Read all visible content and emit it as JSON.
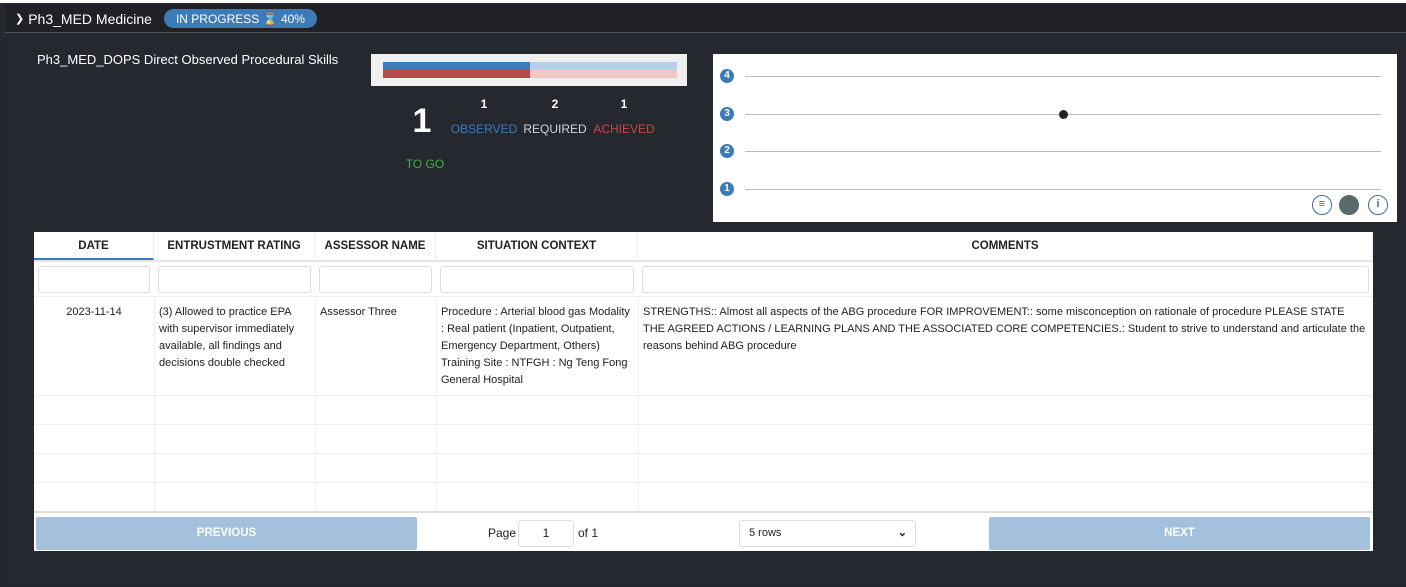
{
  "header": {
    "title": "Ph3_MED Medicine",
    "status": "IN PROGRESS",
    "progress": "40%"
  },
  "module": {
    "title": "Ph3_MED_DOPS Direct Observed Procedural Skills",
    "to_go": {
      "value": "1",
      "label": "TO GO"
    },
    "observed": {
      "value": "1",
      "label": "OBSERVED"
    },
    "required": {
      "value": "2",
      "label": "REQUIRED"
    },
    "achieved": {
      "value": "1",
      "label": "ACHIEVED"
    },
    "bar_fill_fraction": 0.5,
    "colors": {
      "observed": "#3d7ab8",
      "achieved": "#b94a4a",
      "to_go": "#3cb043"
    }
  },
  "chart_data": {
    "type": "scatter",
    "yticks": [
      "1",
      "2",
      "3",
      "4"
    ],
    "ylim": [
      1,
      4
    ],
    "grid": true,
    "points": [
      {
        "x": "2023-11-14",
        "x_fraction": 0.5,
        "y": 3
      }
    ],
    "icons": [
      "sliders-icon",
      "chart-action-icon",
      "info-icon"
    ]
  },
  "table": {
    "columns": [
      "DATE",
      "ENTRUSTMENT RATING",
      "ASSESSOR NAME",
      "SITUATION CONTEXT",
      "COMMENTS"
    ],
    "rows": [
      [
        "2023-11-14",
        "(3) Allowed to practice EPA with supervisor immediately available, all findings and decisions double checked",
        "Assessor Three",
        "Procedure : Arterial blood gas Modality : Real patient (Inpatient, Outpatient, Emergency Department, Others) Training Site : NTFGH : Ng Teng Fong General Hospital",
        "STRENGTHS:: Almost all aspects of the ABG procedure FOR IMPROVEMENT:: some misconception on rationale of procedure PLEASE STATE THE AGREED ACTIONS / LEARNING PLANS AND THE ASSOCIATED CORE COMPETENCIES.: Student to strive to understand and articulate the reasons behind ABG procedure"
      ]
    ]
  },
  "pagination": {
    "previous": "PREVIOUS",
    "next": "NEXT",
    "page_label": "Page",
    "page": "1",
    "of": "of 1",
    "rows_option": "5 rows"
  }
}
